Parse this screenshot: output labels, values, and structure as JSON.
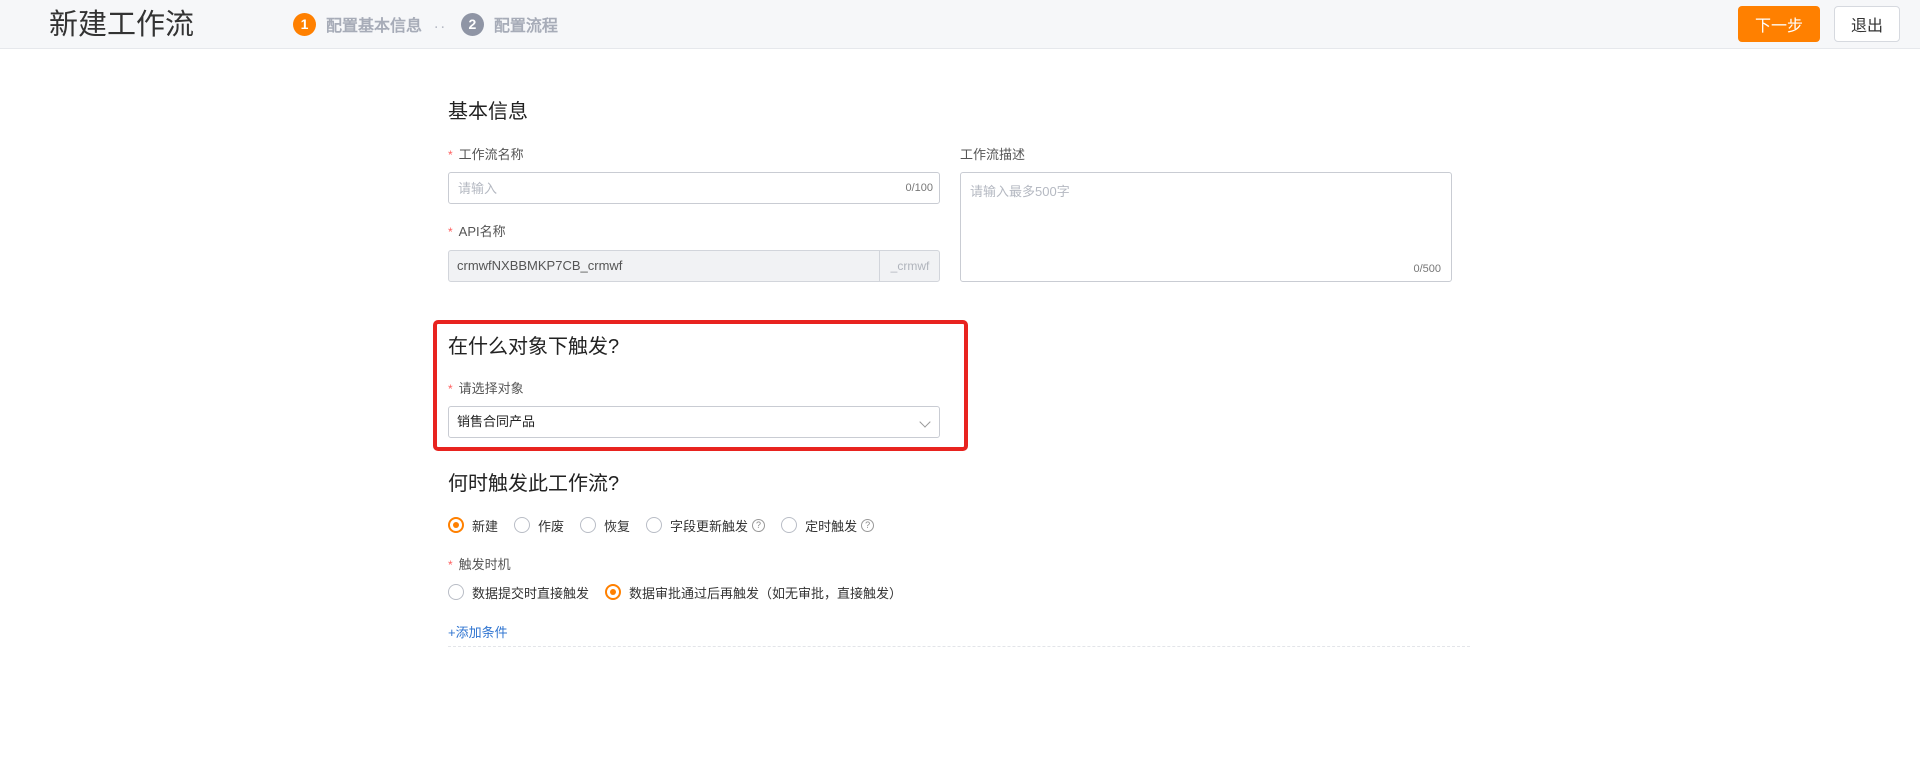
{
  "app": {
    "title": "新建工作流"
  },
  "steps": [
    {
      "num": "1",
      "label": "配置基本信息"
    },
    {
      "num": "2",
      "label": "配置流程"
    }
  ],
  "step_separator": "..",
  "header": {
    "next_label": "下一步",
    "exit_label": "退出"
  },
  "basic": {
    "title": "基本信息",
    "name_label": "工作流名称",
    "name_placeholder": "请输入",
    "name_counter": "0/100",
    "api_label": "API名称",
    "api_value": "crmwfNXBBMKP7CB_crmwf",
    "api_suffix": "_crmwf",
    "desc_label": "工作流描述",
    "desc_placeholder": "请输入最多500字",
    "desc_counter": "0/500"
  },
  "object_section": {
    "title": "在什么对象下触发?",
    "select_label": "请选择对象",
    "selected": "销售合同产品"
  },
  "trigger_section": {
    "title": "何时触发此工作流?",
    "types": [
      {
        "label": "新建",
        "checked": true,
        "help": false
      },
      {
        "label": "作废",
        "checked": false,
        "help": false
      },
      {
        "label": "恢复",
        "checked": false,
        "help": false
      },
      {
        "label": "字段更新触发",
        "checked": false,
        "help": true
      },
      {
        "label": "定时触发",
        "checked": false,
        "help": true
      }
    ],
    "timing_label": "触发时机",
    "timing": [
      {
        "label": "数据提交时直接触发",
        "checked": false
      },
      {
        "label": "数据审批通过后再触发（如无审批，直接触发）",
        "checked": true
      }
    ],
    "add_condition": "+添加条件"
  },
  "icons": {
    "help": "question-circle-icon",
    "dropdown": "chevron-down-icon"
  },
  "colors": {
    "accent": "#ff8000",
    "highlight": "#e8231f",
    "link": "#2f74d0"
  }
}
